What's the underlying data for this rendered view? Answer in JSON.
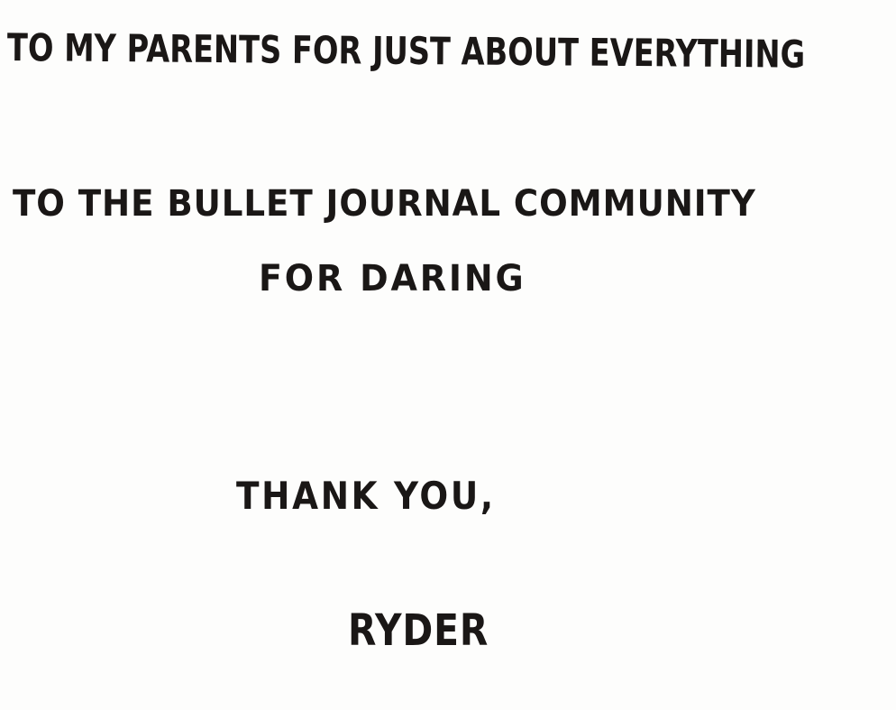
{
  "note": {
    "lines": [
      "TO MY PARENTS FOR JUST ABOUT EVERYTHING",
      "TO THE BULLET JOURNAL COMMUNITY",
      "FOR DARING",
      "THANK YOU,",
      "RYDER"
    ]
  }
}
